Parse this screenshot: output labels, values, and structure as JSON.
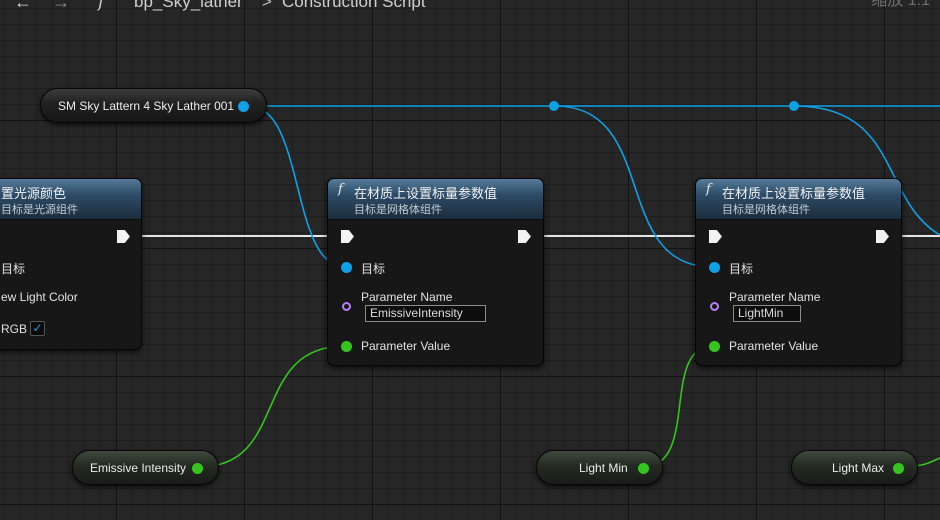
{
  "breadcrumb": {
    "back_glyph": "←",
    "forward_glyph": "→",
    "function_glyph": "f",
    "blueprint": "bp_Sky_lather",
    "separator": ">",
    "function_graph": "Construction Script",
    "zoom_label": "缩放 1:1"
  },
  "variables": {
    "mesh": {
      "label": "SM Sky Lattern 4 Sky Lather 001",
      "pin_color": "#0fa0e6"
    },
    "emissive": {
      "label": "Emissive Intensity",
      "pin_color": "#35c41d"
    },
    "light_min": {
      "label": "Light Min",
      "pin_color": "#35c41d"
    },
    "light_max": {
      "label": "Light Max",
      "pin_color": "#35c41d"
    }
  },
  "nodes": {
    "set_light_color": {
      "title": "置光源颜色",
      "subtitle": "目标是光源组件",
      "target_label": "目标",
      "new_light_color_label": "ew Light Color",
      "srgb_label": "RGB",
      "srgb_checked": true
    },
    "set_scalar_1": {
      "icon": "f",
      "title": "在材质上设置标量参数值",
      "subtitle": "目标是网格体组件",
      "target_label": "目标",
      "param_name_label": "Parameter Name",
      "param_name_value": "EmissiveIntensity",
      "param_value_label": "Parameter Value"
    },
    "set_scalar_2": {
      "icon": "f",
      "title": "在材质上设置标量参数值",
      "subtitle": "目标是网格体组件",
      "target_label": "目标",
      "param_name_label": "Parameter Name",
      "param_name_value": "LightMin",
      "param_value_label": "Parameter Value"
    }
  },
  "colors": {
    "object_wire": "#0fa0e6",
    "float_wire": "#35c41d",
    "name_pin": "#b880ff",
    "exec_wire": "#e6e6e6",
    "header_blue": "#2c4b66"
  }
}
